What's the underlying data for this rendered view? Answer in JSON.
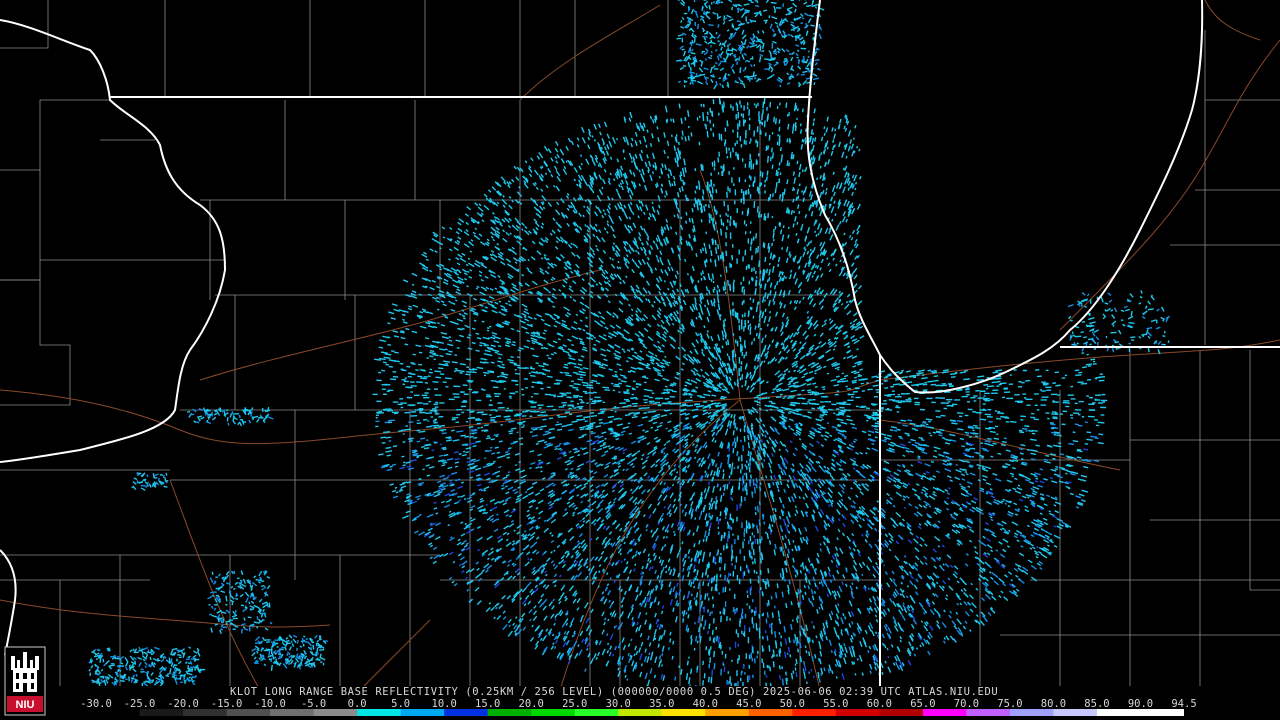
{
  "caption": "KLOT LONG RANGE BASE REFLECTIVITY (0.25KM / 256 LEVEL) (000000/0000 0.5 DEG) 2025-06-06 02:39 UTC  ATLAS.NIU.EDU",
  "logo_text": "NIU",
  "scale": {
    "labels": [
      "-30.0",
      "-25.0",
      "-20.0",
      "-15.0",
      "-10.0",
      "-5.0",
      "0.0",
      "5.0",
      "10.0",
      "15.0",
      "20.0",
      "25.0",
      "30.0",
      "35.0",
      "40.0",
      "45.0",
      "50.0",
      "55.0",
      "60.0",
      "65.0",
      "70.0",
      "75.0",
      "80.0",
      "85.0",
      "90.0",
      "94.5"
    ],
    "colors": [
      "#000000",
      "#1a1a1a",
      "#303030",
      "#505050",
      "#707070",
      "#8c8c8c",
      "#00e5e5",
      "#00a8f0",
      "#0030e0",
      "#00b000",
      "#00d800",
      "#28ff28",
      "#c0e800",
      "#ffe000",
      "#ffa000",
      "#ff6000",
      "#ff2000",
      "#d00000",
      "#b00000",
      "#ff00ff",
      "#c060ff",
      "#a0a0ff",
      "#c8c8ff",
      "#ffffff",
      "#ffffff"
    ]
  },
  "colors": {
    "background": "#000000",
    "state_border": "#ffffff",
    "county_line": "#8c8c8c",
    "roads": "#8a4a2a",
    "echo_light": "#1ec8ee",
    "echo_mid": "#1590e8",
    "echo_dark": "#2244e0"
  }
}
